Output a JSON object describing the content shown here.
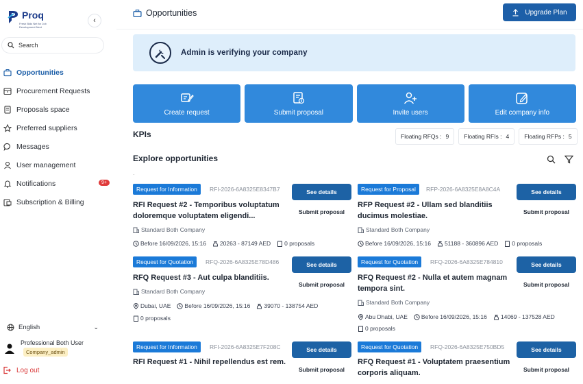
{
  "brand": {
    "name": "Proq",
    "tagline": "Fresh Bids Net for Job Development Next"
  },
  "sidebar": {
    "search_placeholder": "Search",
    "items": [
      {
        "label": "Opportunities",
        "icon": "briefcase-icon",
        "active": true
      },
      {
        "label": "Procurement Requests",
        "icon": "box-icon"
      },
      {
        "label": "Proposals space",
        "icon": "document-icon"
      },
      {
        "label": "Preferred suppliers",
        "icon": "star-icon"
      },
      {
        "label": "Messages",
        "icon": "chat-icon"
      },
      {
        "label": "User management",
        "icon": "user-icon"
      },
      {
        "label": "Notifications",
        "icon": "bell-icon",
        "badge": "9+"
      },
      {
        "label": "Subscription & Billing",
        "icon": "billing-icon"
      }
    ],
    "language": "English",
    "user_name": "Professional Both User",
    "user_role": "Company_admin",
    "logout": "Log out"
  },
  "header": {
    "title": "Opportunities",
    "upgrade_label": "Upgrade Plan"
  },
  "banner": {
    "text": "Admin is verifying your company"
  },
  "actions": [
    {
      "label": "Create request",
      "icon": "request-icon"
    },
    {
      "label": "Submit proposal",
      "icon": "proposal-icon"
    },
    {
      "label": "Invite users",
      "icon": "invite-icon"
    },
    {
      "label": "Edit company info",
      "icon": "edit-icon"
    }
  ],
  "kpis": {
    "title": "KPIs",
    "items": [
      {
        "label": "Floating RFQs :",
        "value": "9"
      },
      {
        "label": "Floating RFIs :",
        "value": "4"
      },
      {
        "label": "Floating RFPs :",
        "value": "5"
      }
    ]
  },
  "explore": {
    "title": "Explore opportunities",
    "separator": "·"
  },
  "cards": [
    {
      "type": "Request for Information",
      "ref": "RFI-2026-6A8325E8347B7",
      "title": "RFI Request #2 - Temporibus voluptatum doloremque voluptatem eligendi...",
      "company": "Standard Both Company",
      "location": "",
      "deadline": "Before 16/09/2026, 15:16",
      "budget": "20263 - 87149 AED",
      "proposals": "0 proposals",
      "details_label": "See details",
      "submit_label": "Submit proposal"
    },
    {
      "type": "Request for Proposal",
      "ref": "RFP-2026-6A8325E8A8C4A",
      "title": "RFP Request #2 - Ullam sed blanditiis ducimus molestiae.",
      "company": "Standard Both Company",
      "location": "",
      "deadline": "Before 16/09/2026, 15:16",
      "budget": "51188 - 360896 AED",
      "proposals": "0 proposals",
      "details_label": "See details",
      "submit_label": "Submit proposal"
    },
    {
      "type": "Request for Quotation",
      "ref": "RFQ-2026-6A8325E78D486",
      "title": "RFQ Request #3 - Aut culpa blanditiis.",
      "company": "Standard Both Company",
      "location": "Dubai, UAE",
      "deadline": "Before 16/09/2026, 15:16",
      "budget": "39070 - 138754 AED",
      "proposals": "0 proposals",
      "details_label": "See details",
      "submit_label": "Submit proposal"
    },
    {
      "type": "Request for Quotation",
      "ref": "RFQ-2026-6A8325E784810",
      "title": "RFQ Request #2 - Nulla et autem magnam tempora sint.",
      "company": "Standard Both Company",
      "location": "Abu Dhabi, UAE",
      "deadline": "Before 16/09/2026, 15:16",
      "budget": "14069 - 137528 AED",
      "proposals": "0 proposals",
      "details_label": "See details",
      "submit_label": "Submit proposal"
    },
    {
      "type": "Request for Information",
      "ref": "RFI-2026-6A8325E7F208C",
      "title": "RFI Request #1 - Nihil repellendus est rem.",
      "company": "",
      "location": "",
      "deadline": "",
      "budget": "",
      "proposals": "",
      "details_label": "See details",
      "submit_label": "Submit proposal"
    },
    {
      "type": "Request for Quotation",
      "ref": "RFQ-2026-6A8325E750BD5",
      "title": "RFQ Request #1 - Voluptatem praesentium corporis aliquam.",
      "company": "",
      "location": "",
      "deadline": "",
      "budget": "",
      "proposals": "",
      "details_label": "See details",
      "submit_label": "Submit proposal"
    }
  ],
  "colors": {
    "primary": "#1d62a5",
    "action_blue": "#3189dc",
    "badge_blue": "#1b7ad8",
    "banner_bg": "#deeefb",
    "danger": "#d93636"
  }
}
